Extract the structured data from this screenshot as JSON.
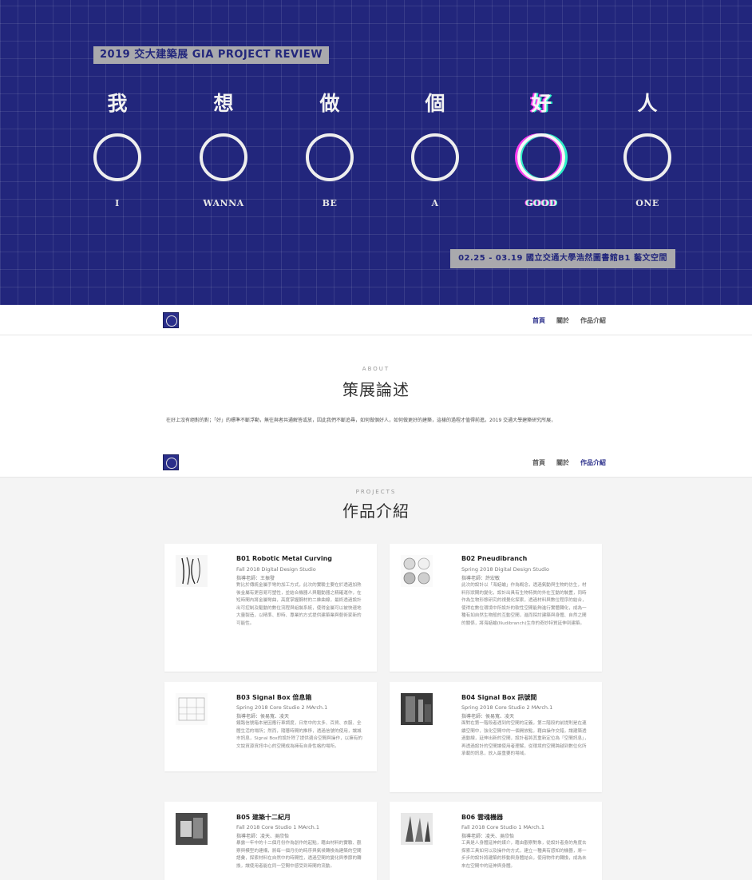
{
  "hero": {
    "badge": "2019 交大建築展 GIA PROJECT REVIEW",
    "characters": [
      "我",
      "想",
      "做",
      "個",
      "好",
      "人"
    ],
    "words": [
      "I",
      "WANNA",
      "BE",
      "A",
      "GOOD",
      "ONE"
    ],
    "glitch_index": 4,
    "date_banner": "02.25 - 03.19 國立交通大學浩然圖書館B1  藝文空間"
  },
  "nav": {
    "links": [
      "首頁",
      "關於",
      "作品介紹"
    ]
  },
  "about": {
    "kicker": "ABOUT",
    "title": "策展論述",
    "text": "在好上沒有絕對的對；「好」的標準不斷浮動，無往與者共通解答或放，因此我們不斷追尋，如何做個好人，如何做更好的建築，這樣的過程才值得前進。2019 交通大學建築研究所展，"
  },
  "projects": {
    "kicker": "PROJECTS",
    "title": "作品介紹",
    "items": [
      {
        "title": "B01 Robotic Metal Curving",
        "term": "Fall 2018 Digital Design Studio",
        "advisor": "指導老師：王振發",
        "desc": "對比於傳統金屬手彎的加工方式，此次的實驗主要在於透過加熱後金屬有更容易可塑性，並結合機器人與驅動器之精確運作，在短時間內將金屬彎曲，高度掌握鋼材的二維曲線，最終透過設計出可控制及驅動的數位流程與組裝系統，使得金屬可以被快速地大量製造，以精準、即時、專業的方式提供建築業與藝術家新的可能性。"
      },
      {
        "title": "B02 Pneudibranch",
        "term": "Spring 2018 Digital Design Studio",
        "advisor": "指導老師：許宏敏",
        "desc": "此次的設計以「海蛞蝓」作為概念，透過氣動與生物的仿生，材料形狀間的變化，設計出具有生物特質的外在互動的裝置，同時作為生物形態研究的視覺化探索，透過材料與數位程序的結合，使得在數位環境中所設計的軟性空間能夠進行實體轉化，成為一種有如自然生物般的互動空間，進而探討建築與身體、自然之間的關係，將海蛞蝓(Nudibranch)生命的奇妙特質延伸到建築。"
      },
      {
        "title": "B03 Signal Box 倍息箱",
        "term": "Spring 2018 Core Studio 2 MArch.1",
        "advisor": "指導老師：侯易寬、凌天",
        "desc": "鐵路信號箱本是因應行車調度，日常中的太多、百貨、衣服、全體生活的場所；然而，隨著時間的推移，透過信號的使用，讓城市訊息，Signal Box的設計除了提供適合空間與操作，以擁有的文說資源資訊中心的空間成為擁有自身性格的場所。"
      },
      {
        "title": "B04 Signal Box 訊號間",
        "term": "Spring 2018 Core Studio 2 MArch.1",
        "advisor": "指導老師：侯易寬、凌天",
        "desc": "面對在第一階段者遇到的空間的定義，第二階段的前提則是在連續空間中，強化空間中的一個開放點，藉由操作交錯，讓建築透過動線，延伸出新的空間，設計者將其重新定位為「空間訊息」，再透過設計的空間讓使用者理解，從環境的空間跨越到數位化所承載的訊息，放入最重要的場域。"
      },
      {
        "title": "B05 建築十二紀月",
        "term": "Fall 2018 Core Studio 1 MArch.1",
        "advisor": "指導老師：凌天、吳欣怡",
        "desc": "暴露一年中的十二個月份作為創作的起點，藉由材料的實驗、觀察與模型的建構，將每一個月份的時序與氣候轉換為建築的空間語彙，探索材料在自然中的時間性，透過空間的變化與季節的轉換，讓使用者能在同一空間中感受到時間的流動。"
      },
      {
        "title": "B06 雲魂機器",
        "term": "Fall 2018 Core Studio 1 MArch.1",
        "advisor": "指導老師：凌天、吳欣怡",
        "desc": "工具是人身體延伸的媒介，藉由觀察對象，從設計者身的角度去探索工具如何以及操作的方式，建立一種具有感知的機器，將一步步的設計將建築的移動與身體結合，使用物件的轉換，成為未來在空間中的延伸與身體。"
      }
    ]
  },
  "colors": {
    "hero_bg": "#22267c",
    "badge_bg": "#a9a9ad",
    "accent": "#2a2e8a",
    "glitch_magenta": "#ff3df2",
    "glitch_cyan": "#2bf3c8",
    "projects_bg": "#f4f4f4"
  },
  "icons": {
    "nav_logo": "circle-logo-icon"
  }
}
